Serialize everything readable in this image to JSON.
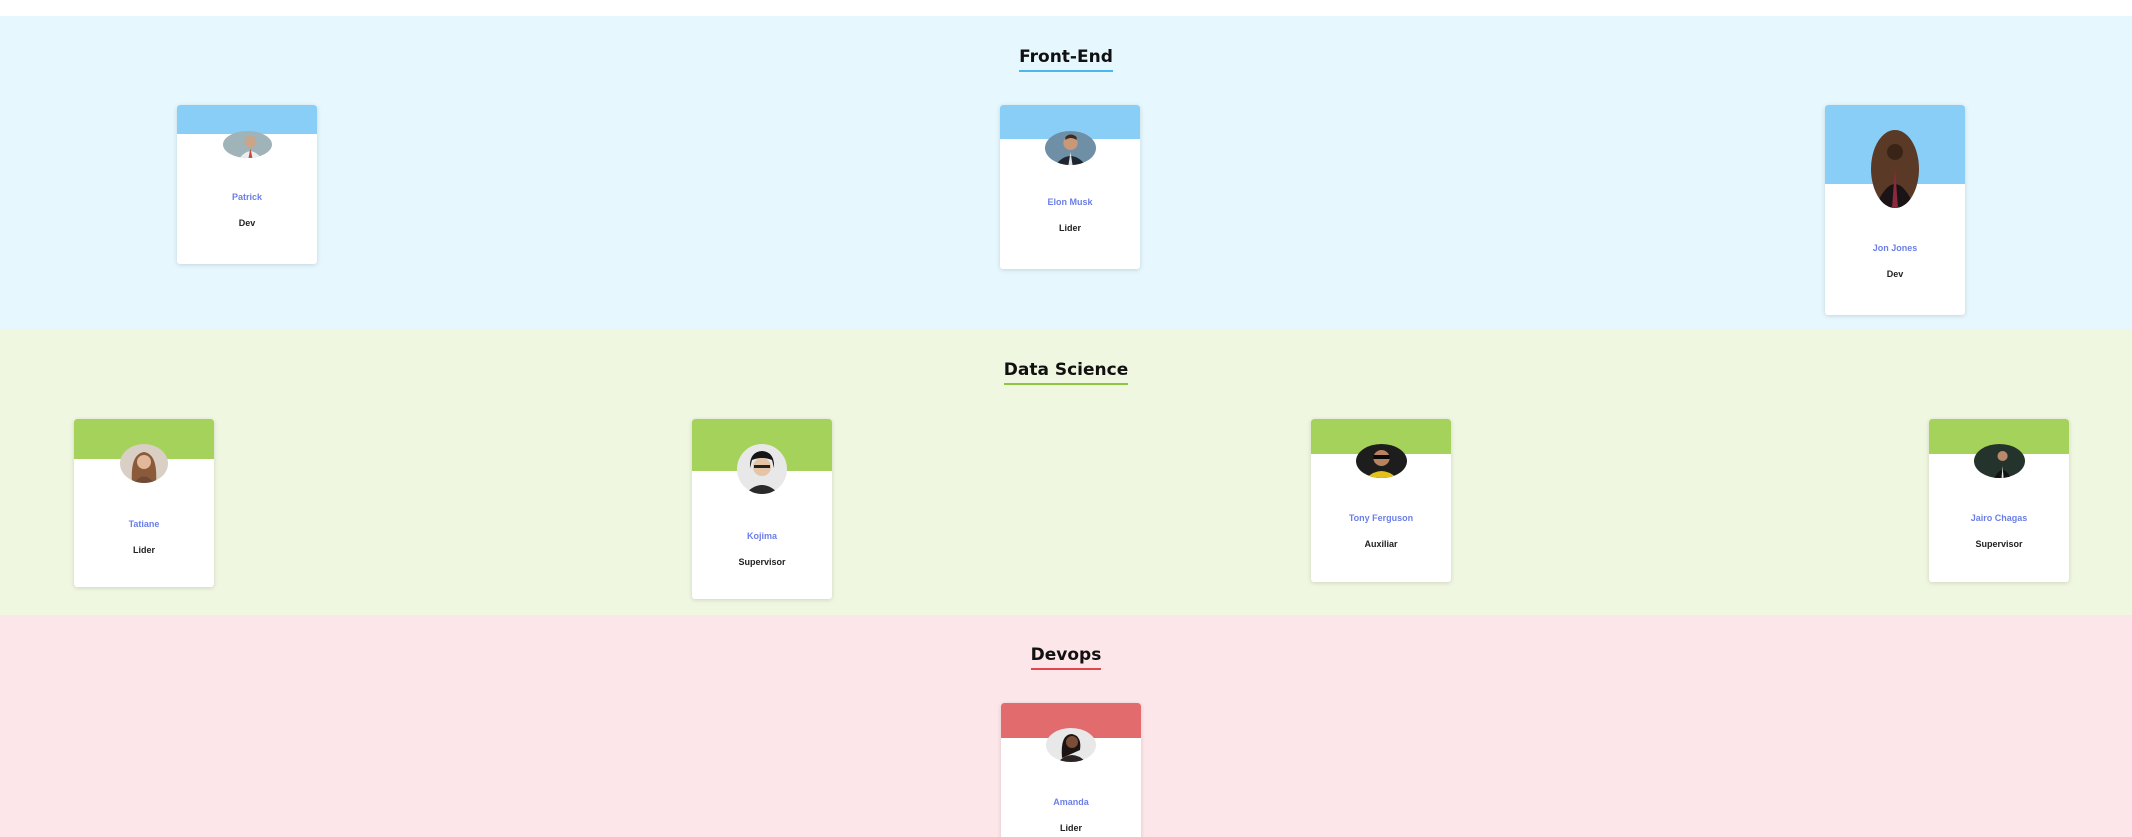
{
  "sections": [
    {
      "title": "Front-End",
      "accent": "#88cef6",
      "members": [
        {
          "name": "Patrick",
          "role": "Dev"
        },
        {
          "name": "Elon Musk",
          "role": "Lider"
        },
        {
          "name": "Jon Jones",
          "role": "Dev"
        }
      ]
    },
    {
      "title": "Data Science",
      "accent": "#a5d25a",
      "members": [
        {
          "name": "Tatiane",
          "role": "Lider"
        },
        {
          "name": "Kojima",
          "role": "Supervisor"
        },
        {
          "name": "Tony Ferguson",
          "role": "Auxiliar"
        },
        {
          "name": "Jairo Chagas",
          "role": "Supervisor"
        }
      ]
    },
    {
      "title": "Devops",
      "accent": "#e26b6e",
      "members": [
        {
          "name": "Amanda",
          "role": "Lider"
        }
      ]
    }
  ]
}
